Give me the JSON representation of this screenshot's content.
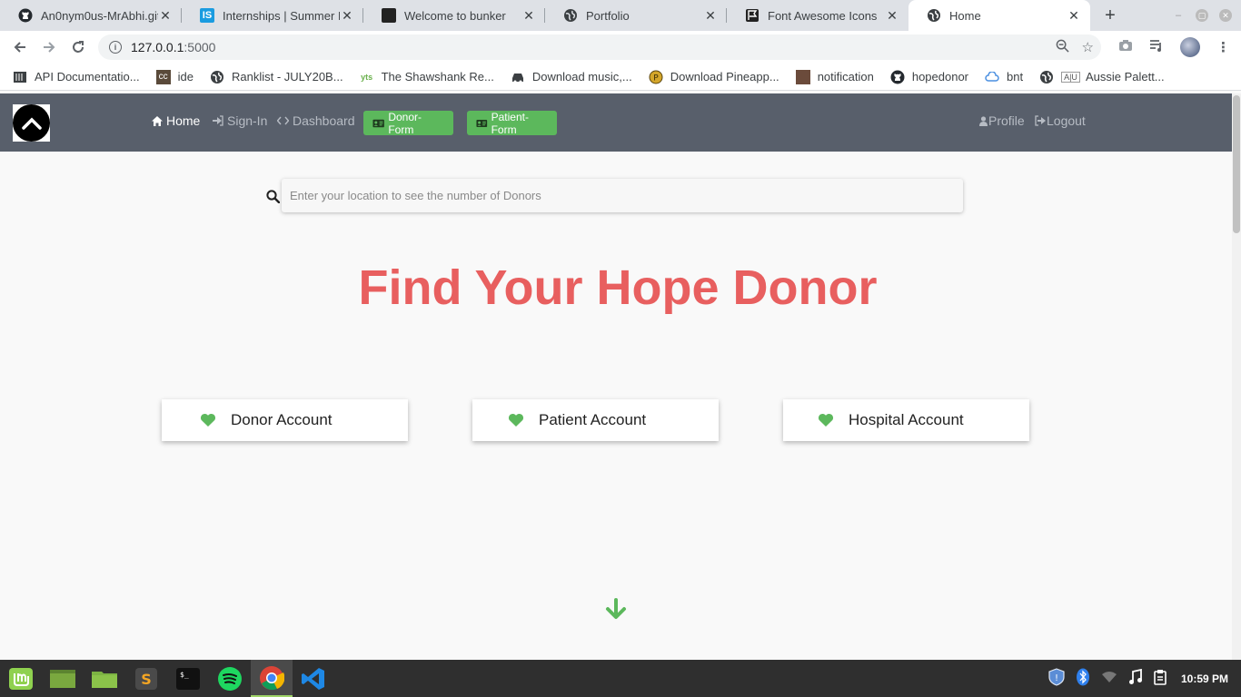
{
  "browser": {
    "tabs": [
      {
        "title": "An0nym0us-MrAbhi.gith",
        "icon": "github-icon"
      },
      {
        "title": "Internships | Summer In",
        "icon": "internshala-icon"
      },
      {
        "title": "Welcome to bunker",
        "icon": "bunker-icon"
      },
      {
        "title": "Portfolio",
        "icon": "globe-icon"
      },
      {
        "title": "Font Awesome Icons",
        "icon": "flag-icon"
      },
      {
        "title": "Home",
        "icon": "globe-icon",
        "active": true
      }
    ],
    "url_host": "127.0.0.1",
    "url_port": ":5000",
    "bookmarks": [
      {
        "label": "API Documentatio...",
        "icon": "book-icon"
      },
      {
        "label": "ide",
        "icon": "cc-icon"
      },
      {
        "label": "Ranklist - JULY20B...",
        "icon": "globe-icon"
      },
      {
        "label": "The Shawshank Re...",
        "icon": "yts-icon"
      },
      {
        "label": "Download music,...",
        "icon": "car-icon"
      },
      {
        "label": "Download Pineapp...",
        "icon": "coin-icon"
      },
      {
        "label": "notification",
        "icon": "portrait-icon"
      },
      {
        "label": "hopedonor",
        "icon": "github-icon"
      },
      {
        "label": "bnt",
        "icon": "cloud-icon"
      },
      {
        "label": "Aussie Palett...",
        "icon": "globe-icon"
      }
    ]
  },
  "nav": {
    "home": "Home",
    "signin": "Sign-In",
    "dashboard": "Dashboard",
    "donor_form": "Donor-Form",
    "patient_form": "Patient-Form",
    "profile": "Profile",
    "logout": "Logout"
  },
  "search": {
    "placeholder": "Enter your location to see the number of Donors"
  },
  "hero": {
    "title": "Find Your Hope Donor"
  },
  "accounts": [
    {
      "label": "Donor Account"
    },
    {
      "label": "Patient Account"
    },
    {
      "label": "Hospital Account"
    }
  ],
  "taskbar": {
    "clock": "10:59 PM"
  },
  "colors": {
    "navbar": "#585f6b",
    "accent_green": "#5cb85c",
    "hero_red": "#e85f5f",
    "heart_green": "#5cb85c"
  }
}
